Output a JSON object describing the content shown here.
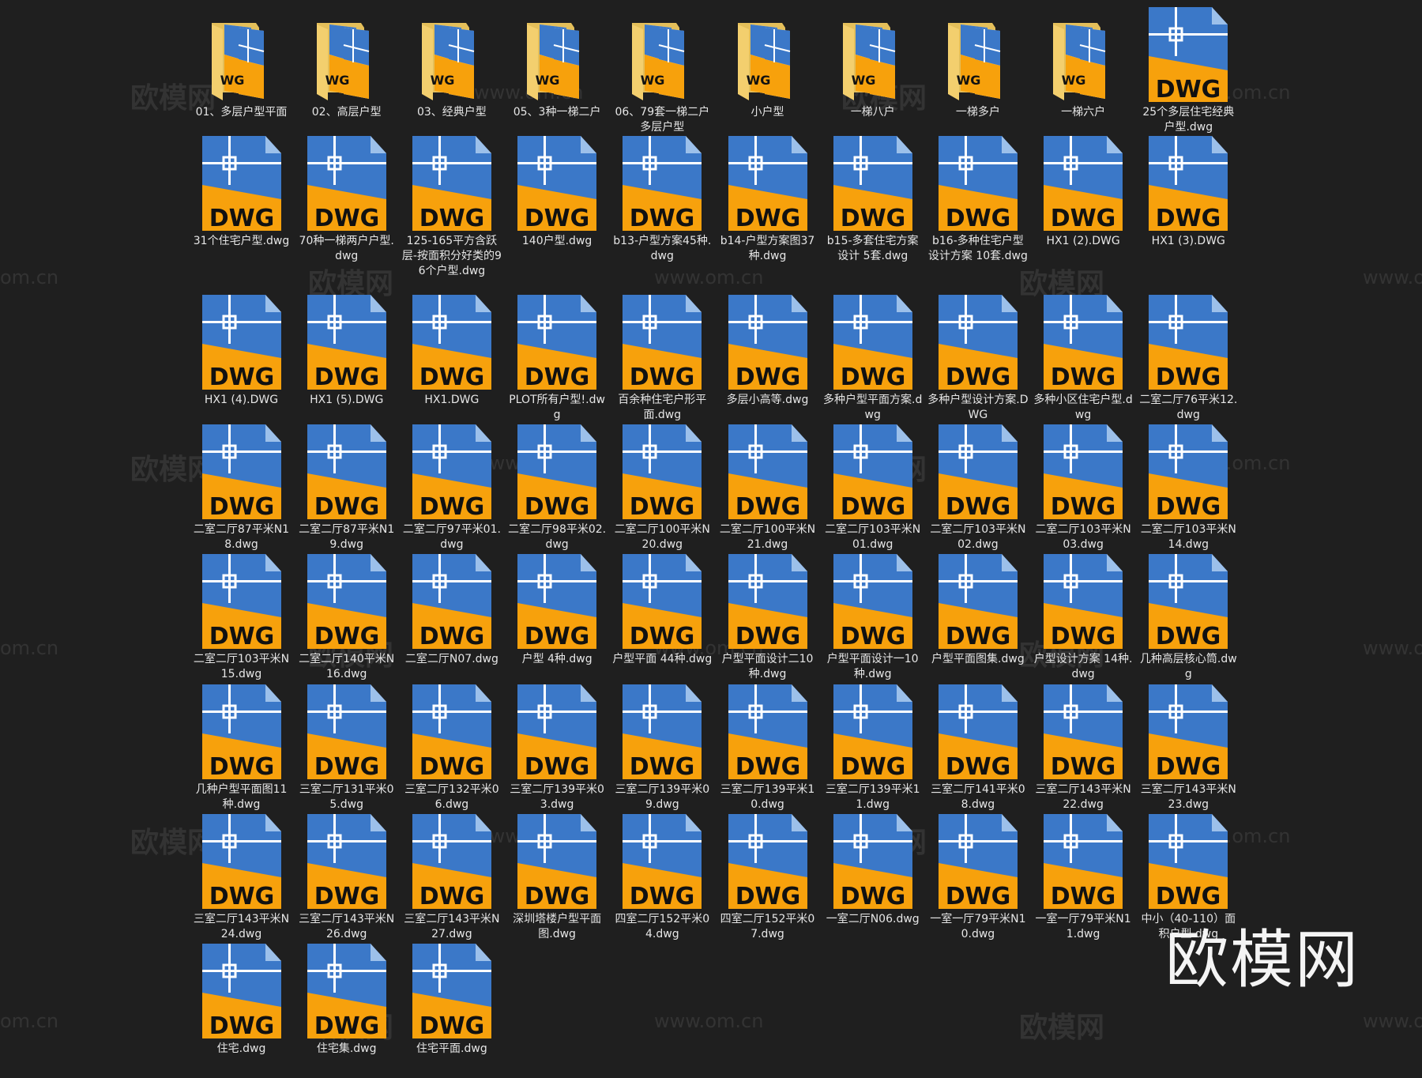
{
  "icon_text": "DWG",
  "folder_text": "WG",
  "colors": {
    "background": "#1f1f1f",
    "dwg_blue": "#3b78c8",
    "dwg_orange": "#f7a10c",
    "folder": "#f3cf6e"
  },
  "watermarks": {
    "brand": "欧模网",
    "url": "www.om.cn",
    "short_url": "om.cn"
  },
  "logo": "欧模网",
  "rows": [
    [
      {
        "type": "folder",
        "name": "01、多层户型平面"
      },
      {
        "type": "folder",
        "name": "02、高层户型"
      },
      {
        "type": "folder",
        "name": "03、经典户型"
      },
      {
        "type": "folder",
        "name": "05、3种一梯二户"
      },
      {
        "type": "folder",
        "name": "06、79套一梯二户多层户型"
      },
      {
        "type": "folder",
        "name": "小户型"
      },
      {
        "type": "folder",
        "name": "一梯八户"
      },
      {
        "type": "folder",
        "name": "一梯多户"
      },
      {
        "type": "folder",
        "name": "一梯六户"
      },
      {
        "type": "dwg",
        "name": "25个多层住宅经典户型.dwg"
      }
    ],
    [
      {
        "type": "dwg",
        "name": "31个住宅户型.dwg"
      },
      {
        "type": "dwg",
        "name": "70种一梯两户户型.dwg"
      },
      {
        "type": "dwg",
        "name": "125-165平方含跃层-按面积分好类的96个户型.dwg"
      },
      {
        "type": "dwg",
        "name": "140户型.dwg"
      },
      {
        "type": "dwg",
        "name": "b13-户型方案45种.dwg"
      },
      {
        "type": "dwg",
        "name": "b14-户型方案图37种.dwg"
      },
      {
        "type": "dwg",
        "name": "b15-多套住宅方案设计 5套.dwg"
      },
      {
        "type": "dwg",
        "name": "b16-多种住宅户型设计方案 10套.dwg"
      },
      {
        "type": "dwg",
        "name": "HX1 (2).DWG"
      },
      {
        "type": "dwg",
        "name": "HX1 (3).DWG"
      }
    ],
    [
      {
        "type": "dwg",
        "name": "HX1 (4).DWG"
      },
      {
        "type": "dwg",
        "name": "HX1 (5).DWG"
      },
      {
        "type": "dwg",
        "name": "HX1.DWG"
      },
      {
        "type": "dwg",
        "name": "PLOT所有户型!.dwg"
      },
      {
        "type": "dwg",
        "name": "百余种住宅户形平面.dwg"
      },
      {
        "type": "dwg",
        "name": "多层小高等.dwg"
      },
      {
        "type": "dwg",
        "name": "多种户型平面方案.dwg"
      },
      {
        "type": "dwg",
        "name": "多种户型设计方案.DWG"
      },
      {
        "type": "dwg",
        "name": "多种小区住宅户型.dwg"
      },
      {
        "type": "dwg",
        "name": "二室二厅76平米12.dwg"
      }
    ],
    [
      {
        "type": "dwg",
        "name": "二室二厅87平米N18.dwg"
      },
      {
        "type": "dwg",
        "name": "二室二厅87平米N19.dwg"
      },
      {
        "type": "dwg",
        "name": "二室二厅97平米01.dwg"
      },
      {
        "type": "dwg",
        "name": "二室二厅98平米02.dwg"
      },
      {
        "type": "dwg",
        "name": "二室二厅100平米N20.dwg"
      },
      {
        "type": "dwg",
        "name": "二室二厅100平米N21.dwg"
      },
      {
        "type": "dwg",
        "name": "二室二厅103平米N01.dwg"
      },
      {
        "type": "dwg",
        "name": "二室二厅103平米N02.dwg"
      },
      {
        "type": "dwg",
        "name": "二室二厅103平米N03.dwg"
      },
      {
        "type": "dwg",
        "name": "二室二厅103平米N14.dwg"
      }
    ],
    [
      {
        "type": "dwg",
        "name": "二室二厅103平米N15.dwg"
      },
      {
        "type": "dwg",
        "name": "二室二厅140平米N16.dwg"
      },
      {
        "type": "dwg",
        "name": "二室二厅N07.dwg"
      },
      {
        "type": "dwg",
        "name": "户型 4种.dwg"
      },
      {
        "type": "dwg",
        "name": "户型平面 44种.dwg"
      },
      {
        "type": "dwg",
        "name": "户型平面设计二10种.dwg"
      },
      {
        "type": "dwg",
        "name": "户型平面设计一10种.dwg"
      },
      {
        "type": "dwg",
        "name": "户型平面图集.dwg"
      },
      {
        "type": "dwg",
        "name": "户型设计方案 14种.dwg"
      },
      {
        "type": "dwg",
        "name": "几种高层核心筒.dwg"
      }
    ],
    [
      {
        "type": "dwg",
        "name": "几种户型平面图11种.dwg"
      },
      {
        "type": "dwg",
        "name": "三室二厅131平米05.dwg"
      },
      {
        "type": "dwg",
        "name": "三室二厅132平米06.dwg"
      },
      {
        "type": "dwg",
        "name": "三室二厅139平米03.dwg"
      },
      {
        "type": "dwg",
        "name": "三室二厅139平米09.dwg"
      },
      {
        "type": "dwg",
        "name": "三室二厅139平米10.dwg"
      },
      {
        "type": "dwg",
        "name": "三室二厅139平米11.dwg"
      },
      {
        "type": "dwg",
        "name": "三室二厅141平米08.dwg"
      },
      {
        "type": "dwg",
        "name": "三室二厅143平米N22.dwg"
      },
      {
        "type": "dwg",
        "name": "三室二厅143平米N23.dwg"
      }
    ],
    [
      {
        "type": "dwg",
        "name": "三室二厅143平米N24.dwg"
      },
      {
        "type": "dwg",
        "name": "三室二厅143平米N26.dwg"
      },
      {
        "type": "dwg",
        "name": "三室二厅143平米N27.dwg"
      },
      {
        "type": "dwg",
        "name": "深圳塔楼户型平面图.dwg"
      },
      {
        "type": "dwg",
        "name": "四室二厅152平米04.dwg"
      },
      {
        "type": "dwg",
        "name": "四室二厅152平米07.dwg"
      },
      {
        "type": "dwg",
        "name": "一室二厅N06.dwg"
      },
      {
        "type": "dwg",
        "name": "一室一厅79平米N10.dwg"
      },
      {
        "type": "dwg",
        "name": "一室一厅79平米N11.dwg"
      },
      {
        "type": "dwg",
        "name": "中小（40-110）面积户型.dwg"
      }
    ],
    [
      {
        "type": "dwg",
        "name": "住宅.dwg"
      },
      {
        "type": "dwg",
        "name": "住宅集.dwg"
      },
      {
        "type": "dwg",
        "name": "住宅平面.dwg"
      }
    ]
  ]
}
